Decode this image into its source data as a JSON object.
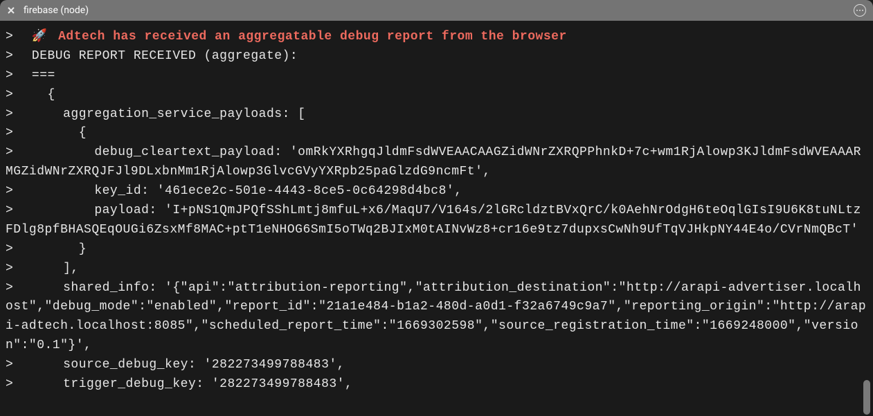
{
  "tab": {
    "title": "firebase (node)"
  },
  "icons": {
    "rocket": "🚀"
  },
  "terminal": {
    "prompt": ">",
    "lines": [
      {
        "type": "highlight",
        "text": "Adtech has received an aggregatable debug report from the browser"
      },
      {
        "type": "plain",
        "text": "DEBUG REPORT RECEIVED (aggregate):"
      },
      {
        "type": "plain",
        "text": "==="
      },
      {
        "type": "plain",
        "text": "  {"
      },
      {
        "type": "plain",
        "text": "    aggregation_service_payloads: ["
      },
      {
        "type": "plain",
        "text": "      {"
      },
      {
        "type": "wrap",
        "text": "        debug_cleartext_payload: 'omRkYXRhgqJldmFsdWVEAACAAGZidWNrZXRQPPhnkD+7c+wm1RjAlowp3KJldmFsdWVEAAARMGZidWNrZXRQJFJl9DLxbnMm1RjAlowp3GlvcGVyYXRpb25paGlzdG9ncmFt',"
      },
      {
        "type": "plain",
        "text": "        key_id: '461ece2c-501e-4443-8ce5-0c64298d4bc8',"
      },
      {
        "type": "wrap",
        "text": "        payload: 'I+pNS1QmJPQfSShLmtj8mfuL+x6/MaqU7/V164s/2lGRcldztBVxQrC/k0AehNrOdgH6teOqlGIsI9U6K8tuNLtzFDlg8pfBHASQEqOUGi6ZsxMf8MAC+ptT1eNHOG6SmI5oTWq2BJIxM0tAINvWz8+cr16e9tz7dupxsCwNh9UfTqVJHkpNY44E4o/CVrNmQBcT'"
      },
      {
        "type": "plain",
        "text": "      }"
      },
      {
        "type": "plain",
        "text": "    ],"
      },
      {
        "type": "wrap",
        "text": "    shared_info: '{\"api\":\"attribution-reporting\",\"attribution_destination\":\"http://arapi-advertiser.localhost\",\"debug_mode\":\"enabled\",\"report_id\":\"21a1e484-b1a2-480d-a0d1-f32a6749c9a7\",\"reporting_origin\":\"http://arapi-adtech.localhost:8085\",\"scheduled_report_time\":\"1669302598\",\"source_registration_time\":\"1669248000\",\"version\":\"0.1\"}',"
      },
      {
        "type": "plain",
        "text": "    source_debug_key: '282273499788483',"
      },
      {
        "type": "plain",
        "text": "    trigger_debug_key: '282273499788483',"
      }
    ]
  }
}
